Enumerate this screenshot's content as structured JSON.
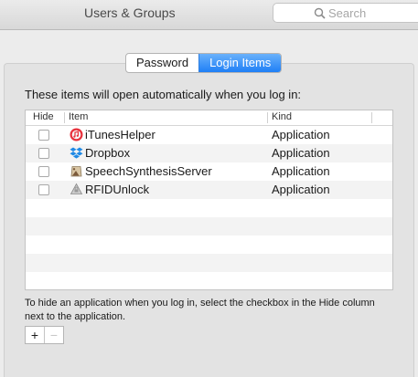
{
  "window": {
    "title": "Users & Groups"
  },
  "search": {
    "placeholder": "Search"
  },
  "tabs": [
    {
      "label": "Password",
      "active": false
    },
    {
      "label": "Login Items",
      "active": true
    }
  ],
  "description": "These items will open automatically when you log in:",
  "table": {
    "columns": {
      "hide": "Hide",
      "item": "Item",
      "kind": "Kind"
    },
    "rows": [
      {
        "name": "iTunesHelper",
        "kind": "Application",
        "icon": "itunes-icon",
        "hidden": false
      },
      {
        "name": "Dropbox",
        "kind": "Application",
        "icon": "dropbox-icon",
        "hidden": false
      },
      {
        "name": "SpeechSynthesisServer",
        "kind": "Application",
        "icon": "speech-synthesis-icon",
        "hidden": false
      },
      {
        "name": "RFIDUnlock",
        "kind": "Application",
        "icon": "rfidunlock-icon",
        "hidden": false
      }
    ]
  },
  "help_text": "To hide an application when you log in, select the checkbox in the Hide column next to the application.",
  "buttons": {
    "add": "+",
    "remove": "−"
  },
  "colors": {
    "accent": "#1f7ff6",
    "row_alt": "#f3f3f3"
  }
}
